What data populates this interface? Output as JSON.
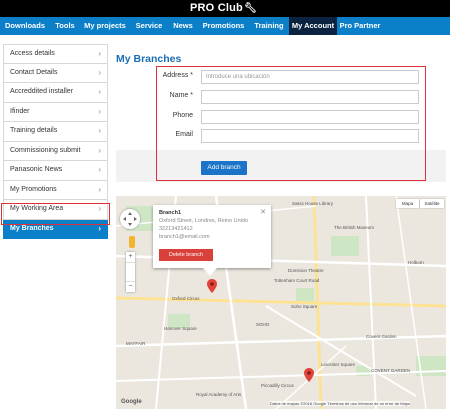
{
  "logo": {
    "text": "PRO Club"
  },
  "nav": {
    "items": [
      {
        "label": "Downloads"
      },
      {
        "label": "Tools"
      },
      {
        "label": "My projects"
      },
      {
        "label": "Service"
      },
      {
        "label": "News"
      },
      {
        "label": "Promotions"
      },
      {
        "label": "Training"
      },
      {
        "label": "My Account"
      },
      {
        "label": "Pro Partner"
      }
    ]
  },
  "sidebar": {
    "items": [
      {
        "label": "Access details"
      },
      {
        "label": "Contact Details"
      },
      {
        "label": "Accreddited installer"
      },
      {
        "label": "Ifinder"
      },
      {
        "label": "Training details"
      },
      {
        "label": "Commissioning submit"
      },
      {
        "label": "Panasonic News"
      },
      {
        "label": "My Promotions"
      },
      {
        "label": "My Working Area"
      },
      {
        "label": "My Branches"
      }
    ]
  },
  "page": {
    "title": "My Branches"
  },
  "form": {
    "address_label": "Address *",
    "address_placeholder": "Introduce una ubicación",
    "name_label": "Name *",
    "phone_label": "Phone",
    "email_label": "Email",
    "add_button": "Add branch"
  },
  "map": {
    "type_map": "Mapa",
    "type_satellite": "Satélite",
    "popup": {
      "title": "Branch1",
      "address": "Oxford Street, Londres, Reino Unido",
      "phone": "32213421412",
      "email": "branch1@email.com",
      "delete_button": "Delete branch"
    },
    "labels": {
      "swiss": "Swiss House Library",
      "british": "The British Museum",
      "dominion": "Dominion Theatre",
      "tottenham": "Tottenham Court Road",
      "oxford": "Oxford Circus",
      "soho": "SOHO",
      "soho_sq": "Soho Square",
      "hanover": "Hanover Square",
      "covent": "Covent Garden",
      "leicester": "Leicester Square",
      "piccadilly": "Piccadilly Circus",
      "holborn": "Holborn",
      "royal": "Royal Academy of Arts",
      "garden": "COVENT GARDEN",
      "mayfair": "MAYFAIR"
    },
    "google": "Google",
    "attribution": "Datos de mapas ©2016 Google   Términos de uso   Informar de un error de Maps"
  }
}
